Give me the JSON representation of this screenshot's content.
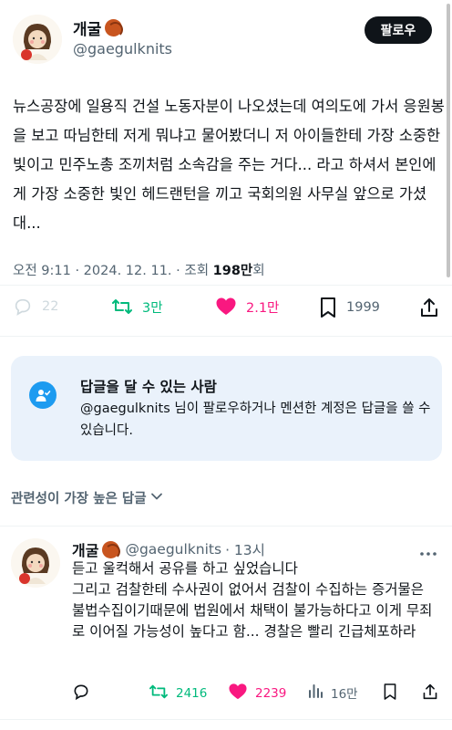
{
  "tweet": {
    "author_name": "개굴",
    "author_handle": "@gaegulknits",
    "follow_label": "팔로우",
    "text": "뉴스공장에 일용직 건설 노동자분이 나오셨는데 여의도에 가서 응원봉을 보고 따님한테 저게 뭐냐고 물어봤더니 저 아이들한테 가장 소중한 빛이고 민주노총 조끼처럼 소속감을 주는 거다... 라고 하셔서 본인에게 가장 소중한 빛인 헤드랜턴을 끼고 국회의원 사무실 앞으로 가셨대...",
    "time": "오전 9:11 · 2024. 12. 11. · 조회 ",
    "views": "198만",
    "views_suffix": "회",
    "stats": {
      "replies": "22",
      "retweets": "3만",
      "likes": "2.1만",
      "bookmarks": "1999"
    }
  },
  "reply_permission": {
    "title": "답글을 달 수 있는 사람",
    "description": "@gaegulknits 님이 팔로우하거나 멘션한 계정은 답글을 쓸 수 있습니다."
  },
  "sort": {
    "label": "관련성이 가장 높은 답글"
  },
  "reply": {
    "author_name": "개굴",
    "author_handle": "@gaegulknits",
    "time": "· 13시",
    "text": "듣고 울컥해서 공유를 하고 싶었습니다\n그리고 검찰한테 수사권이 없어서 검찰이 수집하는 증거물은 불법수집이기때문에 법원에서 채택이 불가능하다고 이게 무죄로 이어질 가능성이 높다고 함... 경찰은 빨리 긴급체포하라",
    "stats": {
      "retweets": "2416",
      "likes": "2239",
      "views": "16만"
    }
  },
  "colors": {
    "like": "#f91880",
    "retweet": "#00ba7c",
    "accent": "#1d9bf0",
    "muted": "#536471"
  }
}
